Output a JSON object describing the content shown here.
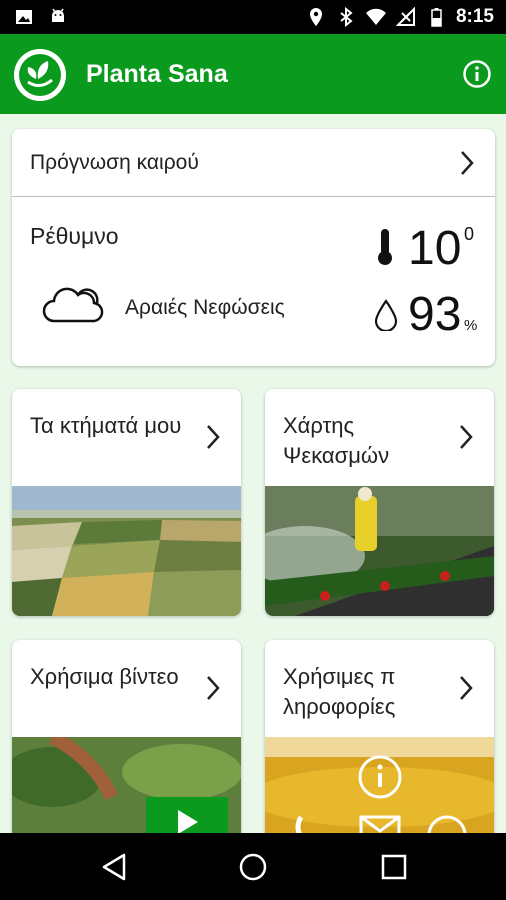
{
  "status_bar": {
    "time": "8:15"
  },
  "app_bar": {
    "title": "Planta Sana"
  },
  "weather": {
    "header": "Πρόγνωση καιρού",
    "city": "Ρέθυμνο",
    "temperature": "10",
    "temperature_unit": "0",
    "condition": "Αραιές Νεφώσεις",
    "humidity": "93",
    "humidity_unit": "%"
  },
  "tiles": [
    {
      "label": "Τα κτήματά μου"
    },
    {
      "label": "Χάρτης Ψεκασμών"
    },
    {
      "label": "Χρήσιμα βίντεο"
    },
    {
      "label": "Χρήσιμες π ληροφορίες"
    }
  ],
  "colors": {
    "primary": "#0a9a1d",
    "background": "#eaf8ea"
  }
}
